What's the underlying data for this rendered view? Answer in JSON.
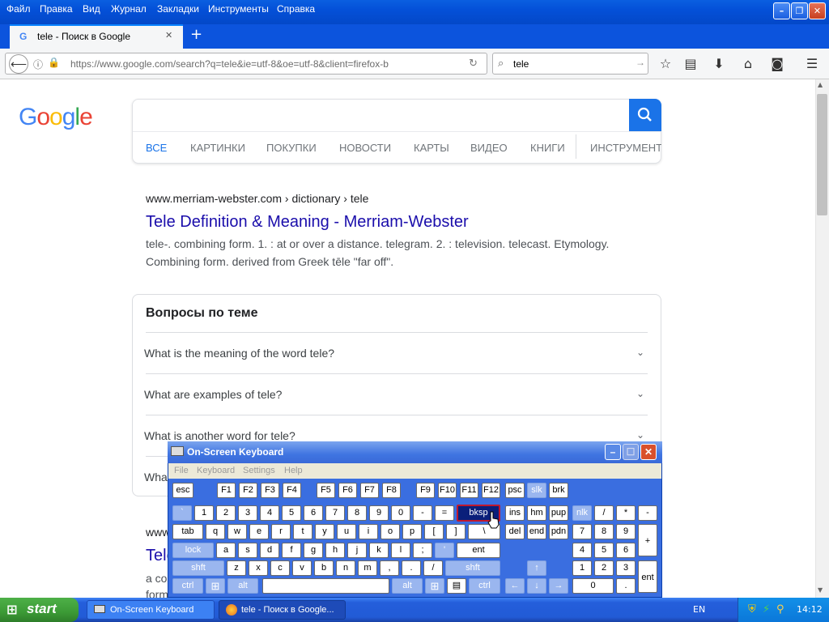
{
  "window": {
    "menu": [
      "Файл",
      "Правка",
      "Вид",
      "Журнал",
      "Закладки",
      "Инструменты",
      "Справка"
    ]
  },
  "tab": {
    "title": "tele - Поиск в Google",
    "close": "✕",
    "new": "+"
  },
  "nav": {
    "url": "https://www.google.com/search?q=tele&ie=utf-8&oe=utf-8&client=firefox-b",
    "search_value": "tele"
  },
  "google": {
    "logo": "Google",
    "tabs": [
      "ВСЕ",
      "КАРТИНКИ",
      "ПОКУПКИ",
      "НОВОСТИ",
      "КАРТЫ",
      "ВИДЕО",
      "КНИГИ",
      "ИНСТРУМЕНТЫ"
    ],
    "result1": {
      "cite": "www.merriam-webster.com › dictionary › tele",
      "title": "Tele Definition & Meaning - Merriam-Webster",
      "snippet1": "tele-. combining form. 1. : at or over a distance. telegram. 2. : television. telecast. Etymology.",
      "snippet2": "Combining form. derived from Greek tēle \"far off\"."
    },
    "paa": {
      "heading": "Вопросы по теме",
      "questions": [
        "What is the meaning of the word tele?",
        "What are examples of tele?",
        "What is another word for tele?",
        "What"
      ]
    },
    "result2": {
      "cite": "www",
      "title": "Tele",
      "s1": "a co",
      "s2": "form"
    }
  },
  "osk": {
    "title": "On-Screen Keyboard",
    "menu": [
      "File",
      "Keyboard",
      "Settings",
      "Help"
    ],
    "rows": [
      [
        "esc",
        "F1",
        "F2",
        "F3",
        "F4",
        "F5",
        "F6",
        "F7",
        "F8",
        "F9",
        "F10",
        "F11",
        "F12",
        "psc",
        "slk",
        "brk"
      ],
      [
        "`",
        "1",
        "2",
        "3",
        "4",
        "5",
        "6",
        "7",
        "8",
        "9",
        "0",
        "-",
        "=",
        "bksp",
        "ins",
        "hm",
        "pup",
        "nlk",
        "/",
        "*",
        "-"
      ],
      [
        "tab",
        "q",
        "w",
        "e",
        "r",
        "t",
        "y",
        "u",
        "i",
        "o",
        "p",
        "[",
        "]",
        "\\",
        "del",
        "end",
        "pdn",
        "7",
        "8",
        "9",
        "+"
      ],
      [
        "lock",
        "a",
        "s",
        "d",
        "f",
        "g",
        "h",
        "j",
        "k",
        "l",
        ";",
        "'",
        "ent",
        "4",
        "5",
        "6"
      ],
      [
        "shft",
        "z",
        "x",
        "c",
        "v",
        "b",
        "n",
        "m",
        ",",
        ".",
        "/",
        "shft",
        "1",
        "2",
        "3",
        "ent"
      ],
      [
        "ctrl",
        "alt",
        "alt",
        "ctrl",
        "0",
        "."
      ]
    ]
  },
  "taskbar": {
    "start": "start",
    "tasks": [
      "On-Screen Keyboard",
      "tele - Поиск в Google..."
    ],
    "lang": "EN",
    "clock": "14:12"
  }
}
